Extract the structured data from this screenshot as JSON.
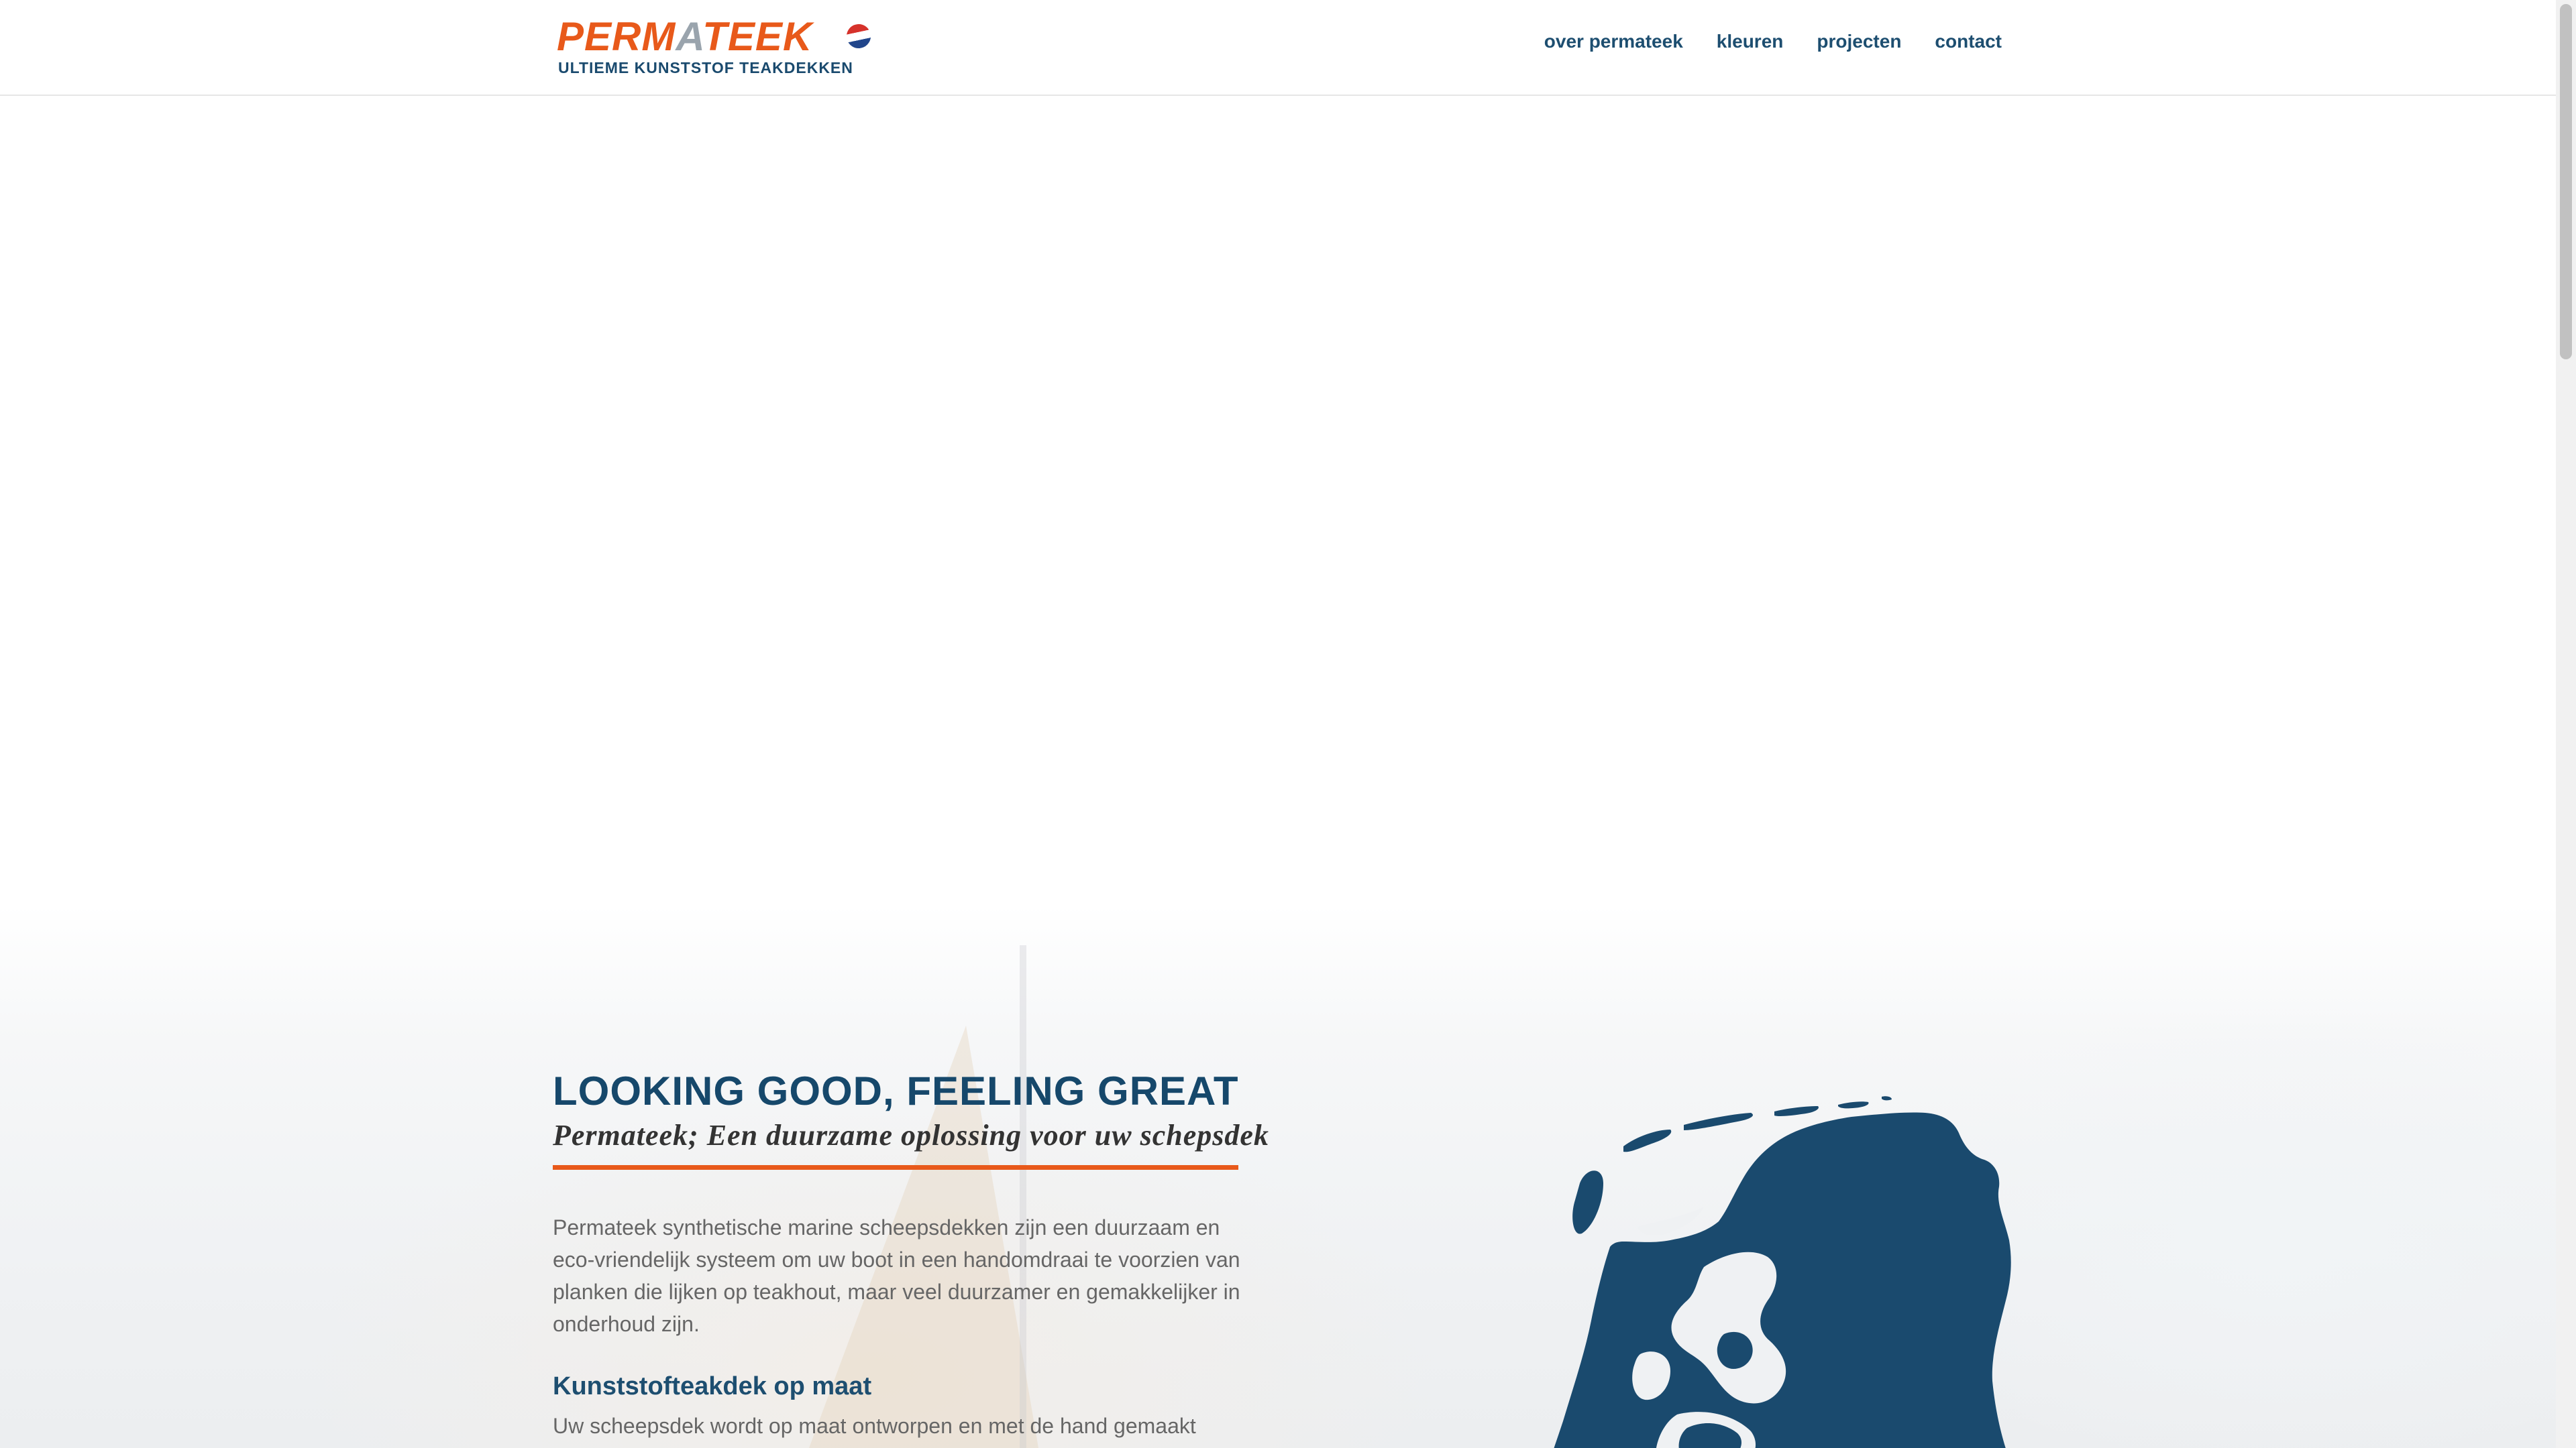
{
  "header": {
    "logo": {
      "word_left": "PERM",
      "word_a": "A",
      "word_right": "TEEK",
      "tagline": "ULTIEME KUNSTSTOF TEAKDEKKEN"
    },
    "nav": [
      "over permateek",
      "kleuren",
      "projecten",
      "contact"
    ]
  },
  "main": {
    "headline": "LOOKING GOOD, FEELING GREAT",
    "subheadline": "Permateek; Een duurzame oplossing voor uw schepsdek",
    "intro": "Permateek synthetische marine scheepsdekken zijn een duurzaam en eco-vriendelijk systeem om uw boot in een handomdraai te voorzien van planken die lijken op teakhout, maar veel duurzamer en gemakkelijker in onderhoud zijn.",
    "section_title": "Kunststofteakdek op maat",
    "section_text": "Uw scheepsdek wordt op maat ontworpen en met de hand gemaakt"
  },
  "colors": {
    "brand_orange": "#e8591a",
    "brand_blue": "#16486b",
    "map_blue": "#1a4a6e"
  },
  "icons": {
    "logo_flag": "netherlands-flag-icon",
    "map": "netherlands-map-icon"
  }
}
